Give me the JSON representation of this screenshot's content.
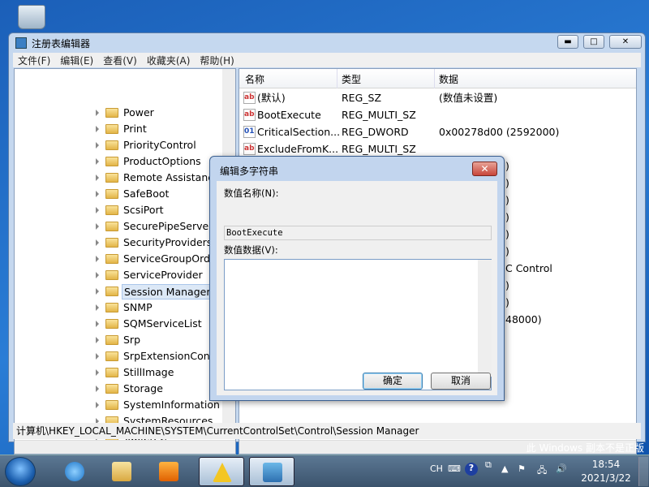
{
  "desktop": {
    "watermark": "此 Windows 副本不是正版"
  },
  "window": {
    "title": "注册表编辑器",
    "minimize": "▬",
    "maximize": "□",
    "close": "✕"
  },
  "menu": [
    "文件(F)",
    "编辑(E)",
    "查看(V)",
    "收藏夹(A)",
    "帮助(H)"
  ],
  "tree": {
    "items": [
      "Power",
      "Print",
      "PriorityControl",
      "ProductOptions",
      "Remote Assistance",
      "SafeBoot",
      "ScsiPort",
      "SecurePipeServers",
      "SecurityProviders",
      "ServiceGroupOrder",
      "ServiceProvider",
      "Session Manager",
      "SNMP",
      "SQMServiceList",
      "Srp",
      "SrpExtensionConfig",
      "StillImage",
      "Storage",
      "SystemInformation",
      "SystemResources",
      "TabletPC"
    ],
    "selected": "Session Manager"
  },
  "list": {
    "columns": [
      "名称",
      "类型",
      "数据"
    ],
    "rows": [
      {
        "icon": "string-value-icon",
        "name": "(默认)",
        "type": "REG_SZ",
        "data": "(数值未设置)"
      },
      {
        "icon": "string-value-icon",
        "name": "BootExecute",
        "type": "REG_MULTI_SZ",
        "data": ""
      },
      {
        "icon": "binary-value-icon",
        "name": "CriticalSection...",
        "type": "REG_DWORD",
        "data": "0x00278d00 (2592000)"
      },
      {
        "icon": "string-value-icon",
        "name": "ExcludeFromK...",
        "type": "REG_MULTI_SZ",
        "data": ""
      }
    ],
    "occluded_fragments": [
      ")",
      ")",
      ")",
      ")",
      ")",
      ")",
      "C Control",
      ")",
      ")",
      "48000)"
    ]
  },
  "status": "计算机\\HKEY_LOCAL_MACHINE\\SYSTEM\\CurrentControlSet\\Control\\Session Manager",
  "dialog": {
    "title": "编辑多字符串",
    "name_label": "数值名称(N):",
    "name_value": "BootExecute",
    "data_label": "数值数据(V):",
    "data_value": "",
    "ok": "确定",
    "cancel": "取消",
    "close": "✕"
  },
  "taskbar": {
    "lang": "CH",
    "time": "18:54",
    "date": "2021/3/22"
  }
}
